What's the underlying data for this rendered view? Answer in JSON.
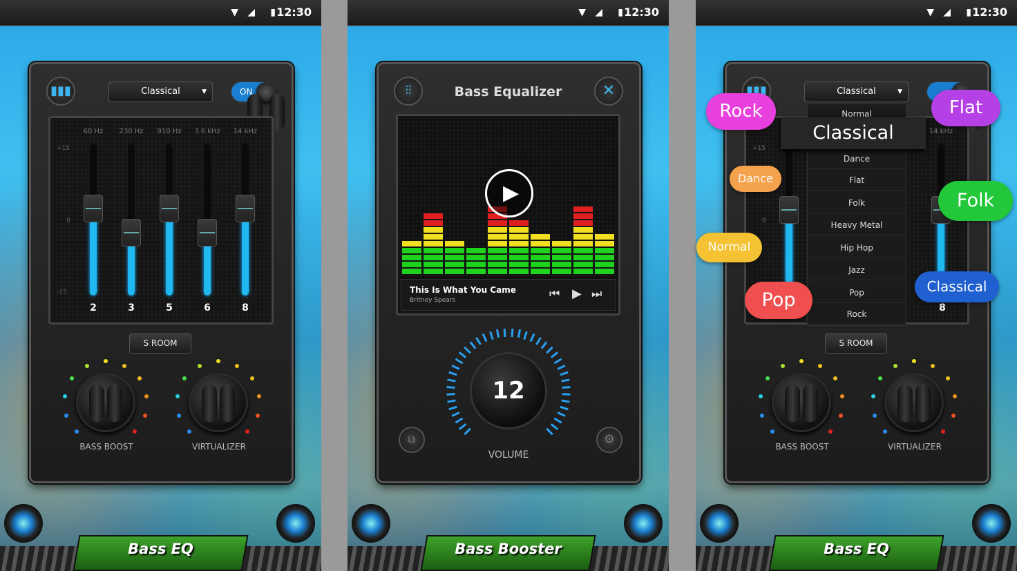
{
  "status_bar": {
    "time": "12:30"
  },
  "screen1": {
    "preset": "Classical",
    "toggle": "ON",
    "bands": [
      {
        "freq": "60 Hz",
        "label": "2",
        "level_db": 3
      },
      {
        "freq": "230 Hz",
        "label": "3",
        "level_db": -2
      },
      {
        "freq": "910 Hz",
        "label": "5",
        "level_db": 3
      },
      {
        "freq": "3.6 kHz",
        "label": "6",
        "level_db": -2
      },
      {
        "freq": "14 kHz",
        "label": "8",
        "level_db": 3
      }
    ],
    "scale": {
      "top": "+15",
      "mid": "0",
      "bottom": "-15"
    },
    "sroom": "S ROOM",
    "knobs": [
      "BASS BOOST",
      "VIRTUALIZER"
    ],
    "banner": "Bass EQ"
  },
  "screen2": {
    "title": "Bass  Equalizer",
    "visualizer_levels": [
      5,
      9,
      5,
      4,
      10,
      8,
      6,
      5,
      10,
      6
    ],
    "track": {
      "title": "This Is What You Came",
      "artist": "Britney Spears"
    },
    "volume": {
      "value": "12",
      "label": "VOLUME"
    },
    "banner": "Bass Booster"
  },
  "screen3": {
    "preset": "Classical",
    "dropdown_items": [
      "Normal",
      "Classical",
      "Dance",
      "Flat",
      "Folk",
      "Heavy Metal",
      "Hip Hop",
      "Jazz",
      "Pop",
      "Rock"
    ],
    "selected": "Classical",
    "visible_band": {
      "freq": "14 kHz",
      "label": "8"
    },
    "scale": {
      "top": "+15",
      "mid": "0"
    },
    "sroom": "S ROOM",
    "knobs": [
      "BASS BOOST",
      "VIRTUALIZER"
    ],
    "bubbles": [
      {
        "label": "Rock",
        "color": "#e840dc"
      },
      {
        "label": "Flat",
        "color": "#b440e6"
      },
      {
        "label": "Dance",
        "color": "#f5a24c"
      },
      {
        "label": "Folk",
        "color": "#22c83a"
      },
      {
        "label": "Normal",
        "color": "#f4c232"
      },
      {
        "label": "Classical",
        "color": "#1f5fcf"
      },
      {
        "label": "Pop",
        "color": "#f04f4f"
      }
    ],
    "banner": "Bass EQ"
  }
}
